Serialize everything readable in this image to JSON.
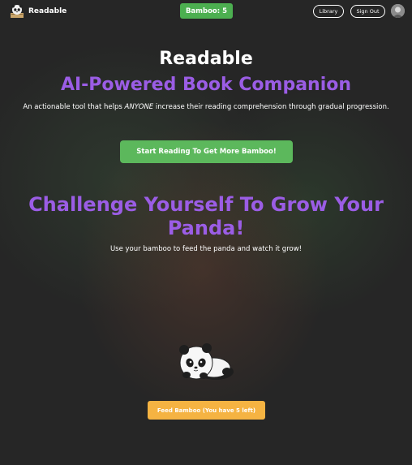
{
  "header": {
    "brand": "Readable",
    "bamboo_badge": "Bamboo: 5",
    "library_label": "Library",
    "signout_label": "Sign Out"
  },
  "hero": {
    "title": "Readable",
    "subtitle": "AI-Powered Book Companion",
    "desc_before": "An actionable tool that helps ",
    "desc_emphasis": "ANYONE",
    "desc_after": " increase their reading comprehension through gradual progression.",
    "cta_label": "Start Reading To Get More Bamboo!"
  },
  "challenge": {
    "title": "Challenge Yourself To Grow Your Panda!",
    "desc": "Use your bamboo to feed the panda and watch it grow!",
    "feed_label": "Feed Bamboo (You have 5 left)"
  },
  "icons": {
    "logo": "panda-reading-logo-icon",
    "avatar": "user-avatar",
    "panda": "panda-mascot-icon"
  },
  "colors": {
    "accent_purple": "#9b5de5",
    "bamboo_green": "#4caf50",
    "cta_green": "#5cb85c",
    "feed_orange": "#f5b342",
    "background": "#262626"
  }
}
